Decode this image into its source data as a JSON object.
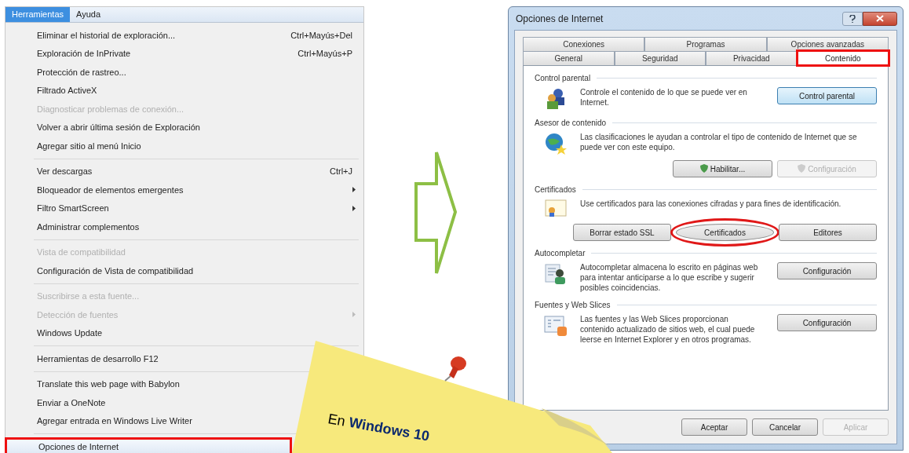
{
  "menu_bar": [
    {
      "label": "Herramientas",
      "selected": true
    },
    {
      "label": "Ayuda",
      "selected": false
    }
  ],
  "menu_groups": [
    [
      {
        "label": "Eliminar el historial de exploración...",
        "shortcut": "Ctrl+Mayús+Del",
        "disabled": false,
        "submenu": false,
        "selected": false
      },
      {
        "label": "Exploración de InPrivate",
        "shortcut": "Ctrl+Mayús+P",
        "disabled": false,
        "submenu": false,
        "selected": false
      },
      {
        "label": "Protección de rastreo...",
        "disabled": false,
        "submenu": false,
        "selected": false
      },
      {
        "label": "Filtrado ActiveX",
        "disabled": false,
        "submenu": false,
        "selected": false
      },
      {
        "label": "Diagnosticar problemas de conexión...",
        "disabled": true,
        "submenu": false,
        "selected": false
      },
      {
        "label": "Volver a abrir última sesión de Exploración",
        "disabled": false,
        "submenu": false,
        "selected": false
      },
      {
        "label": "Agregar sitio al menú Inicio",
        "disabled": false,
        "submenu": false,
        "selected": false
      }
    ],
    [
      {
        "label": "Ver descargas",
        "shortcut": "Ctrl+J",
        "disabled": false,
        "submenu": false,
        "selected": false
      },
      {
        "label": "Bloqueador de elementos emergentes",
        "disabled": false,
        "submenu": true,
        "selected": false
      },
      {
        "label": "Filtro SmartScreen",
        "disabled": false,
        "submenu": true,
        "selected": false
      },
      {
        "label": "Administrar complementos",
        "disabled": false,
        "submenu": false,
        "selected": false
      }
    ],
    [
      {
        "label": "Vista de compatibilidad",
        "disabled": true,
        "submenu": false,
        "selected": false
      },
      {
        "label": "Configuración de Vista de compatibilidad",
        "disabled": false,
        "submenu": false,
        "selected": false
      }
    ],
    [
      {
        "label": "Suscribirse a esta fuente...",
        "disabled": true,
        "submenu": false,
        "selected": false
      },
      {
        "label": "Detección de fuentes",
        "disabled": true,
        "submenu": true,
        "selected": false
      },
      {
        "label": "Windows Update",
        "disabled": false,
        "submenu": false,
        "selected": false
      }
    ],
    [
      {
        "label": "Herramientas de desarrollo F12",
        "disabled": false,
        "submenu": false,
        "selected": false
      }
    ],
    [
      {
        "label": "Translate this web page with Babylon",
        "disabled": false,
        "submenu": false,
        "selected": false
      },
      {
        "label": "Enviar a OneNote",
        "disabled": false,
        "submenu": false,
        "selected": false
      },
      {
        "label": "Agregar entrada en Windows Live Writer",
        "disabled": false,
        "submenu": false,
        "selected": false
      }
    ],
    [
      {
        "label": "Opciones de Internet",
        "disabled": false,
        "submenu": false,
        "selected": true
      }
    ]
  ],
  "dialog": {
    "title": "Opciones de Internet",
    "tab_rows": [
      [
        {
          "label": "Conexiones",
          "selected": false
        },
        {
          "label": "Programas",
          "selected": false
        },
        {
          "label": "Opciones avanzadas",
          "selected": false
        }
      ],
      [
        {
          "label": "General",
          "selected": false
        },
        {
          "label": "Seguridad",
          "selected": false
        },
        {
          "label": "Privacidad",
          "selected": false
        },
        {
          "label": "Contenido",
          "selected": true
        }
      ]
    ],
    "sections": [
      {
        "title": "Control parental",
        "kind": "side",
        "text": "Controle el contenido de lo que se puede ver en Internet.",
        "buttons": [
          {
            "label": "Control parental",
            "disabled": false,
            "focused": true,
            "highlighted": false
          }
        ]
      },
      {
        "title": "Asesor de contenido",
        "kind": "row",
        "text": "Las clasificaciones le ayudan a controlar el tipo de contenido de Internet que se puede ver con este equipo.",
        "buttons": [
          {
            "label": "Habilitar...",
            "disabled": false,
            "focused": false,
            "highlighted": false,
            "kind": "shield"
          },
          {
            "label": "Configuración",
            "disabled": true,
            "focused": false,
            "highlighted": false,
            "kind": "shield"
          }
        ]
      },
      {
        "title": "Certificados",
        "kind": "row3",
        "text": "Use certificados para las conexiones cifradas y para fines de identificación.",
        "buttons": [
          {
            "label": "Borrar estado SSL",
            "disabled": false,
            "focused": false,
            "highlighted": false
          },
          {
            "label": "Certificados",
            "disabled": false,
            "focused": false,
            "highlighted": true
          },
          {
            "label": "Editores",
            "disabled": false,
            "focused": false,
            "highlighted": false
          }
        ]
      },
      {
        "title": "Autocompletar",
        "kind": "side",
        "text": "Autocompletar almacena lo escrito en páginas web para intentar anticiparse a lo que escribe y sugerir posibles coincidencias.",
        "buttons": [
          {
            "label": "Configuración",
            "disabled": false,
            "focused": false,
            "highlighted": false
          }
        ]
      },
      {
        "title": "Fuentes y Web Slices",
        "kind": "side",
        "text": "Las fuentes y las Web Slices proporcionan contenido actualizado de sitios web, el cual puede leerse en Internet Explorer y en otros programas.",
        "buttons": [
          {
            "label": "Configuración",
            "disabled": false,
            "focused": false,
            "highlighted": false
          }
        ]
      }
    ],
    "footer_buttons": [
      {
        "label": "Aceptar",
        "disabled": false
      },
      {
        "label": "Cancelar",
        "disabled": false
      },
      {
        "label": "Aplicar",
        "disabled": true
      }
    ]
  },
  "sticky_note": {
    "text": "En **Windows 10**"
  }
}
